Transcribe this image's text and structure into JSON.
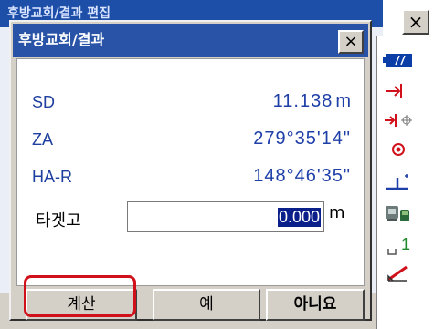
{
  "background": {
    "window_title": "후방교회/결과 편집",
    "close_label": "×"
  },
  "dialog": {
    "title": "후방교회/결과",
    "close_label": "×",
    "rows": [
      {
        "label": "SD",
        "value": "11.138",
        "unit": "m"
      },
      {
        "label": "ZA",
        "value": "279°35'14\"",
        "unit": ""
      },
      {
        "label": "HA-R",
        "value": "148°46'35\"",
        "unit": ""
      }
    ],
    "target_height": {
      "label": "타겟고",
      "value": "0.000",
      "unit": "m"
    },
    "buttons": {
      "calc": "계산",
      "yes": "예",
      "no": "아니요"
    }
  },
  "side_icons": [
    {
      "name": "battery-icon"
    },
    {
      "name": "target-arrow-icon"
    },
    {
      "name": "target-crosshair-icon"
    },
    {
      "name": "prism-icon"
    },
    {
      "name": "tilt-icon"
    },
    {
      "name": "instrument-comm-icon"
    },
    {
      "name": "face-indicator-icon"
    },
    {
      "name": "edit-pencil-icon"
    }
  ],
  "side_text": {
    "face_number": "1"
  },
  "colors": {
    "title_bar": "#2853a6",
    "label_blue": "#1f3fa0",
    "highlight_red": "#d0111b"
  }
}
